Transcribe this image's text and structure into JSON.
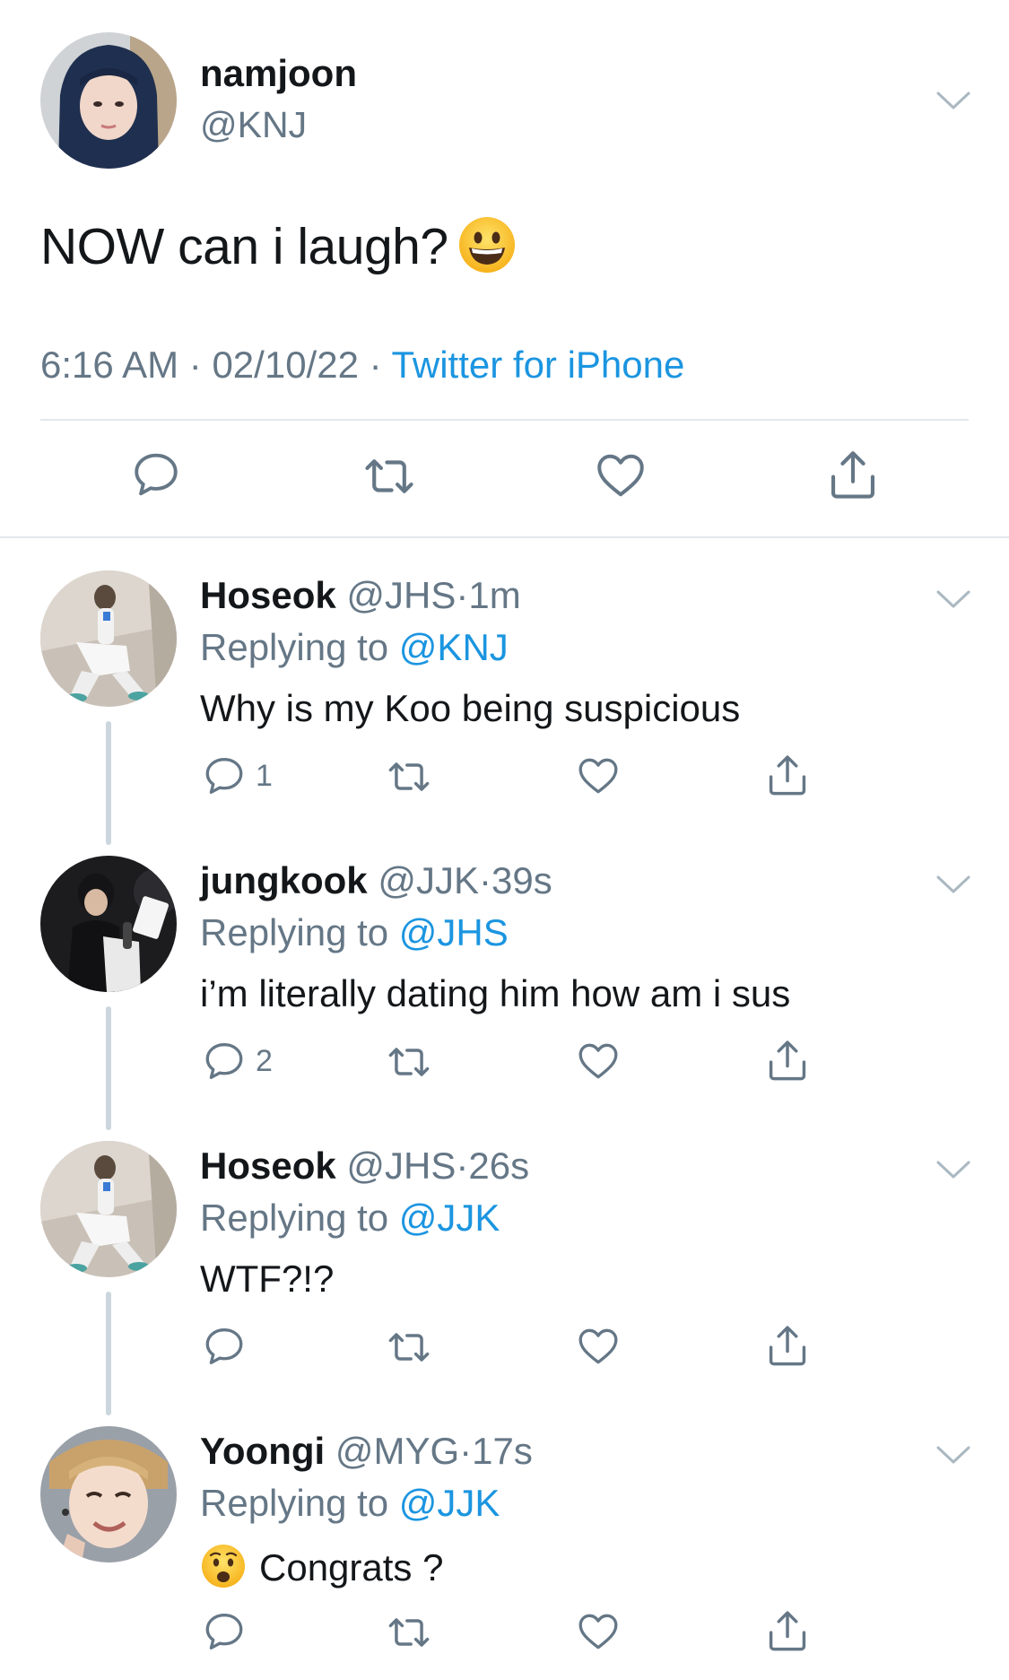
{
  "main_tweet": {
    "name": "namjoon",
    "handle": "@KNJ",
    "text": "NOW can i laugh?",
    "emoji": "grinning-face",
    "time": "6:16 AM",
    "date": "02/10/22",
    "separator": "·",
    "source": "Twitter for iPhone"
  },
  "icons": {
    "reply": "reply-bubble-icon",
    "retweet": "retweet-icon",
    "like": "heart-icon",
    "share": "share-icon",
    "menu": "chevron-down-icon"
  },
  "colors": {
    "link": "#1b95e0",
    "secondary": "#657786",
    "primary_text": "#14171a",
    "divider": "#e1e8ed",
    "thread_line": "#ccd6dd"
  },
  "replies": [
    {
      "name": "Hoseok",
      "handle": "@JHS",
      "dot": "·",
      "time": "1m",
      "replying_prefix": "Replying to",
      "replying_to": "@KNJ",
      "text": "Why is my Koo being suspicious",
      "reply_count": "1"
    },
    {
      "name": "jungkook",
      "handle": "@JJK",
      "dot": "·",
      "time": "39s",
      "replying_prefix": "Replying to",
      "replying_to": "@JHS",
      "text": "i’m literally dating him how am i sus",
      "reply_count": "2"
    },
    {
      "name": "Hoseok",
      "handle": "@JHS",
      "dot": "·",
      "time": "26s",
      "replying_prefix": "Replying to",
      "replying_to": "@JJK",
      "text": "WTF?!?",
      "reply_count": ""
    },
    {
      "name": "Yoongi",
      "handle": "@MYG",
      "dot": "·",
      "time": "17s",
      "replying_prefix": "Replying to",
      "replying_to": "@JJK",
      "text": "Congrats ?",
      "emoji": "anguished-face",
      "reply_count": ""
    }
  ]
}
